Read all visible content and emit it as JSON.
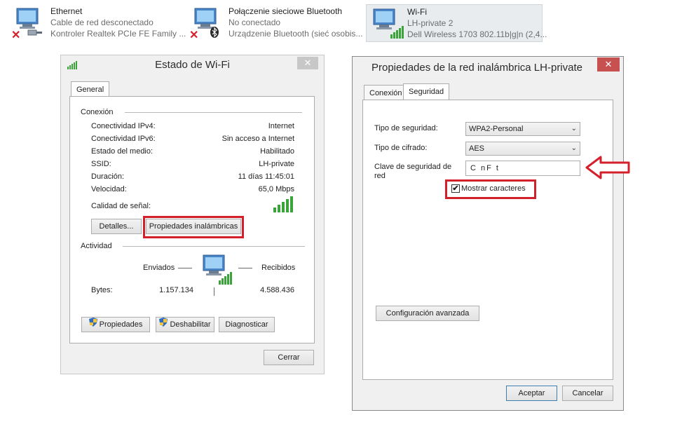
{
  "adapters": [
    {
      "name": "Ethernet",
      "status": "Cable de red desconectado",
      "device": "Kontroler Realtek PCIe FE Family ..."
    },
    {
      "name": "Połączenie sieciowe Bluetooth",
      "status": "No conectado",
      "device": "Urządzenie Bluetooth (sieć osobis..."
    },
    {
      "name": "Wi-Fi",
      "status": "LH-private  2",
      "device": "Dell Wireless 1703 802.11b|g|n (2,4..."
    }
  ],
  "wifi_status": {
    "title": "Estado de Wi-Fi",
    "close": "✕",
    "tab_general": "General",
    "connection_header": "Conexión",
    "rows": [
      {
        "label": "Conectividad IPv4:",
        "value": "Internet"
      },
      {
        "label": "Conectividad IPv6:",
        "value": "Sin acceso a Internet"
      },
      {
        "label": "Estado del medio:",
        "value": "Habilitado"
      },
      {
        "label": "SSID:",
        "value": "LH-private"
      },
      {
        "label": "Duración:",
        "value": "11 días 11:45:01"
      },
      {
        "label": "Velocidad:",
        "value": "65,0 Mbps"
      }
    ],
    "signal_label": "Calidad de señal:",
    "details_button": "Detalles...",
    "wireless_props_button": "Propiedades inalámbricas",
    "activity_header": "Actividad",
    "sent_label": "Enviados",
    "received_label": "Recibidos",
    "bytes_label": "Bytes:",
    "bytes_sent": "1.157.134",
    "bytes_received": "4.588.436",
    "properties_button": "Propiedades",
    "disable_button": "Deshabilitar",
    "diagnose_button": "Diagnosticar",
    "close_button": "Cerrar"
  },
  "wireless_props": {
    "title": "Propiedades de la red inalámbrica LH-private",
    "close": "✕",
    "tab_connection": "Conexión",
    "tab_security": "Seguridad",
    "security_type_label": "Tipo de seguridad:",
    "security_type_value": "WPA2-Personal",
    "encryption_label": "Tipo de cifrado:",
    "encryption_value": "AES",
    "key_label": "Clave de seguridad de red",
    "key_value": "C  nF  t",
    "show_chars_label": "Mostrar caracteres",
    "show_chars_checked": "✔",
    "advanced_button": "Configuración avanzada",
    "accept_button": "Aceptar",
    "cancel_button": "Cancelar"
  },
  "colors": {
    "highlight": "#d4202b",
    "signal": "#3aa33a"
  }
}
